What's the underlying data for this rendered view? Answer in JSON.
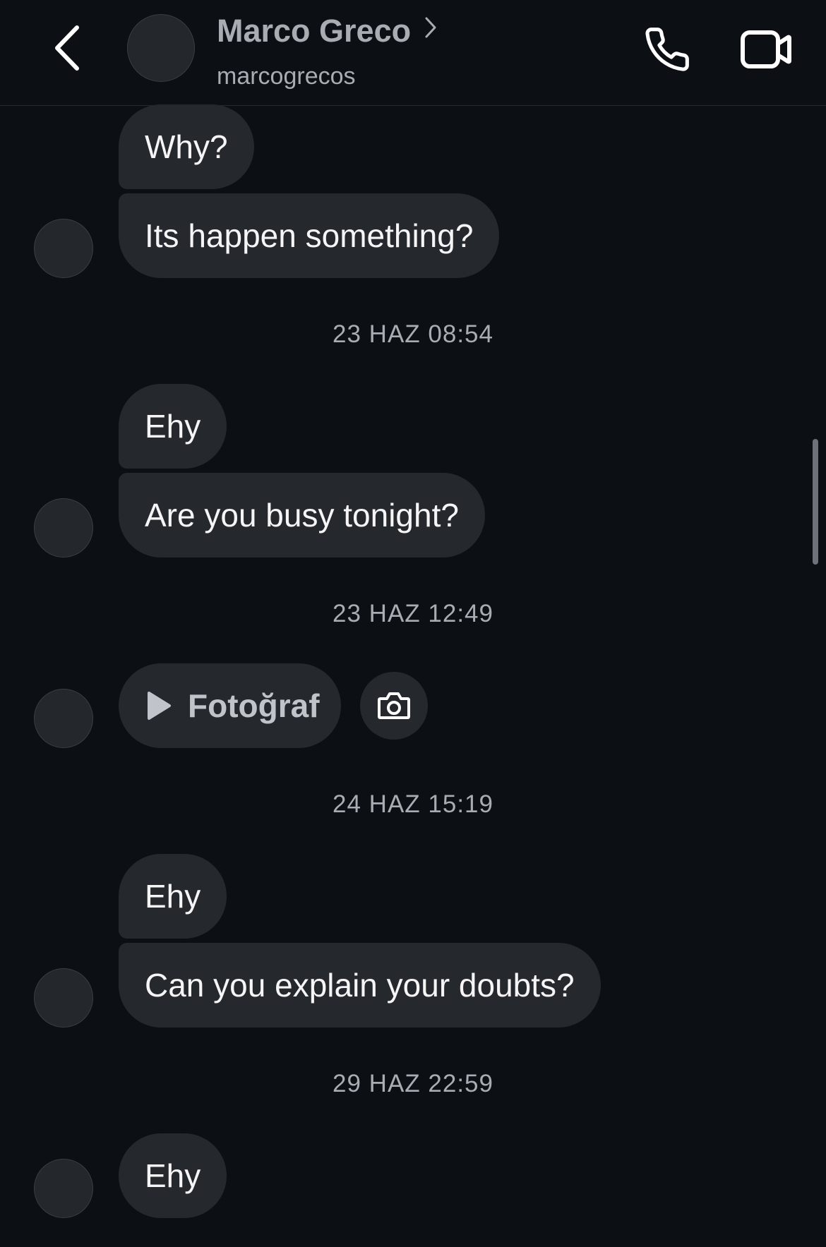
{
  "header": {
    "contact_name": "Marco Greco",
    "contact_handle": "marcogrecos",
    "icons": {
      "back": "chevron-left-icon",
      "profile": "chevron-right-icon",
      "call": "phone-icon",
      "video": "video-camera-icon"
    }
  },
  "messages": {
    "m1": "Why?",
    "m2": "Its happen something?",
    "ts1": "23 HAZ 08:54",
    "m3": "Ehy",
    "m4": "Are you busy tonight?",
    "ts2": "23 HAZ 12:49",
    "media_label": "Fotoğraf",
    "media_icon": "play-icon",
    "camera_icon": "camera-icon",
    "ts3": "24 HAZ 15:19",
    "m5": "Ehy",
    "m6": "Can you explain your doubts?",
    "ts4": "29 HAZ 22:59",
    "m7": "Ehy"
  },
  "colors": {
    "background": "#0c1014",
    "bubble": "#25292e",
    "text": "#f5f5f5",
    "secondary_text": "#a8adb4"
  }
}
